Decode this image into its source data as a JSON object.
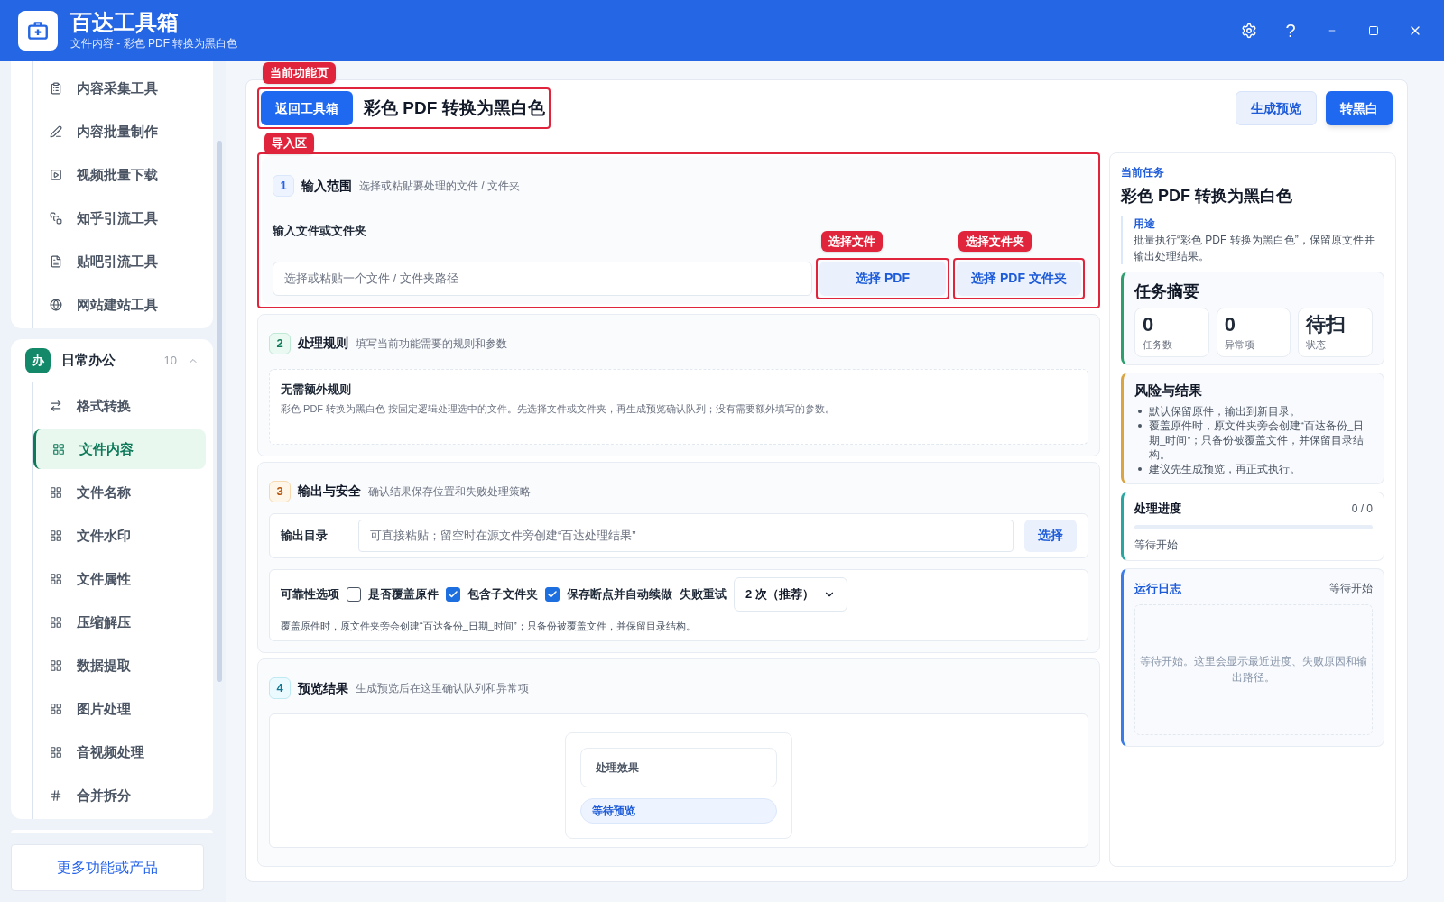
{
  "window": {
    "title": "百达工具箱",
    "subtitle": "文件内容 - 彩色 PDF 转换为黑白色",
    "help_label": "?"
  },
  "sidebar": {
    "groups": [
      {
        "items": [
          {
            "label": "内容采集工具",
            "selected": false
          },
          {
            "label": "内容批量制作",
            "selected": false
          },
          {
            "label": "视频批量下载",
            "selected": false
          },
          {
            "label": "知乎引流工具",
            "selected": false
          },
          {
            "label": "贴吧引流工具",
            "selected": false
          },
          {
            "label": "网站建站工具",
            "selected": false
          }
        ]
      },
      {
        "badge": "办",
        "title": "日常办公",
        "count": "10",
        "expanded": true,
        "items": [
          {
            "label": "格式转换",
            "selected": false
          },
          {
            "label": "文件内容",
            "selected": true
          },
          {
            "label": "文件名称",
            "selected": false
          },
          {
            "label": "文件水印",
            "selected": false
          },
          {
            "label": "文件属性",
            "selected": false
          },
          {
            "label": "压缩解压",
            "selected": false
          },
          {
            "label": "数据提取",
            "selected": false
          },
          {
            "label": "图片处理",
            "selected": false
          },
          {
            "label": "音视频处理",
            "selected": false
          },
          {
            "label": "合并拆分",
            "selected": false
          }
        ]
      }
    ],
    "footer_button": "更多功能或产品"
  },
  "page": {
    "callout": "当前功能页",
    "back_button": "返回工具箱",
    "title": "彩色 PDF 转换为黑白色",
    "actions": [
      {
        "label": "生成预览",
        "kind": "secondary"
      },
      {
        "label": "转黑白",
        "kind": "primary"
      }
    ]
  },
  "sections": [
    {
      "kind": "input",
      "number": "1",
      "title": "输入范围",
      "hint": "选择或粘贴要处理的文件 / 文件夹",
      "callout": "导入区",
      "field_label": "输入文件或文件夹",
      "placeholder": "选择或粘贴一个文件 / 文件夹路径",
      "buttons": [
        {
          "label": "选择 PDF",
          "callout": "选择文件"
        },
        {
          "label": "选择 PDF 文件夹",
          "callout": "选择文件夹"
        }
      ]
    },
    {
      "kind": "rules",
      "number": "2",
      "title": "处理规则",
      "hint": "填写当前功能需要的规则和参数",
      "rule_title": "无需额外规则",
      "rule_text": "彩色 PDF 转换为黑白色 按固定逻辑处理选中的文件。先选择文件或文件夹，再生成预览确认队列；没有需要额外填写的参数。"
    },
    {
      "kind": "output",
      "number": "3",
      "title": "输出与安全",
      "hint": "确认结果保存位置和失败处理策略",
      "output_label": "输出目录",
      "placeholder": "可直接粘贴；留空时在源文件旁创建“百达处理结果”",
      "choose_button": "选择",
      "options_label": "可靠性选项",
      "options": [
        {
          "label": "是否覆盖原件",
          "checked": false
        },
        {
          "label": "包含子文件夹",
          "checked": true
        },
        {
          "label": "保存断点并自动续做",
          "checked": true
        }
      ],
      "retry_label": "失败重试",
      "retry_value": "2 次（推荐）",
      "note": "覆盖原件时，原文件夹旁会创建“百达备份_日期_时间”；只备份被覆盖文件，并保留目录结构。"
    },
    {
      "kind": "preview",
      "number": "4",
      "title": "预览结果",
      "hint": "生成预览后在这里确认队列和异常项",
      "effect_label": "处理效果",
      "status": "等待预览"
    }
  ],
  "task_panel": {
    "eyebrow": "当前任务",
    "title": "彩色 PDF 转换为黑白色",
    "purpose_label": "用途",
    "purpose_text": "批量执行“彩色 PDF 转换为黑白色”，保留原文件并输出处理结果。",
    "summary": {
      "title": "任务摘要",
      "stats": [
        {
          "value": "0",
          "label": "任务数"
        },
        {
          "value": "0",
          "label": "异常项"
        },
        {
          "value": "待扫",
          "label": "状态"
        }
      ]
    },
    "risks": {
      "title": "风险与结果",
      "items": [
        "默认保留原件，输出到新目录。",
        "覆盖原件时，原文件夹旁会创建“百达备份_日期_时间”；只备份被覆盖文件，并保留目录结构。",
        "建议先生成预览，再正式执行。"
      ]
    },
    "progress": {
      "title": "处理进度",
      "count": "0 / 0",
      "level": 0,
      "status": "等待开始"
    },
    "log": {
      "title": "运行日志",
      "status": "等待开始",
      "text": "等待开始。这里会显示最近进度、失败原因和输出路径。"
    }
  }
}
